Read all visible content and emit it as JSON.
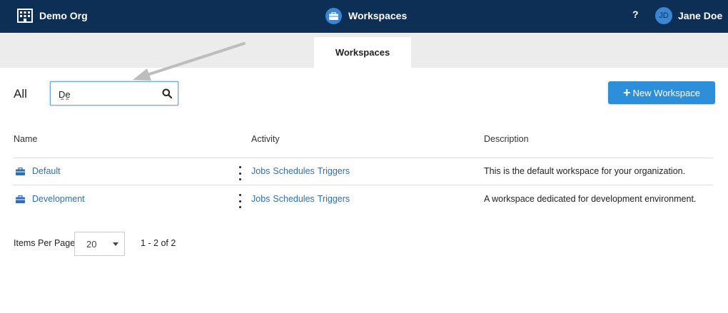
{
  "topbar": {
    "org_name": "Demo Org",
    "title": "Workspaces",
    "help_symbol": "?",
    "user_initials": "JD",
    "user_name": "Jane Doe",
    "icons": {
      "org": "building-icon",
      "title": "briefcase-icon"
    },
    "colors": {
      "bar": "#0d2f55",
      "accent": "#3a86d4"
    }
  },
  "tabs": [
    {
      "label": "Workspaces",
      "active": true
    }
  ],
  "toolbar": {
    "filter_label": "All",
    "search_value": "De",
    "new_button_label": "New Workspace",
    "new_button_icon": "plus-icon"
  },
  "table": {
    "columns": [
      "Name",
      "Activity",
      "Description"
    ],
    "rows": [
      {
        "name": "Default",
        "activity": [
          "Jobs",
          "Schedules",
          "Triggers"
        ],
        "description": "This is the default workspace for your organization."
      },
      {
        "name": "Development",
        "activity": [
          "Jobs",
          "Schedules",
          "Triggers"
        ],
        "description": "A workspace dedicated for development environment."
      }
    ]
  },
  "pagination": {
    "items_per_page_label": "Items Per Page",
    "items_per_page_value": "20",
    "range_text": "1 - 2 of 2"
  }
}
